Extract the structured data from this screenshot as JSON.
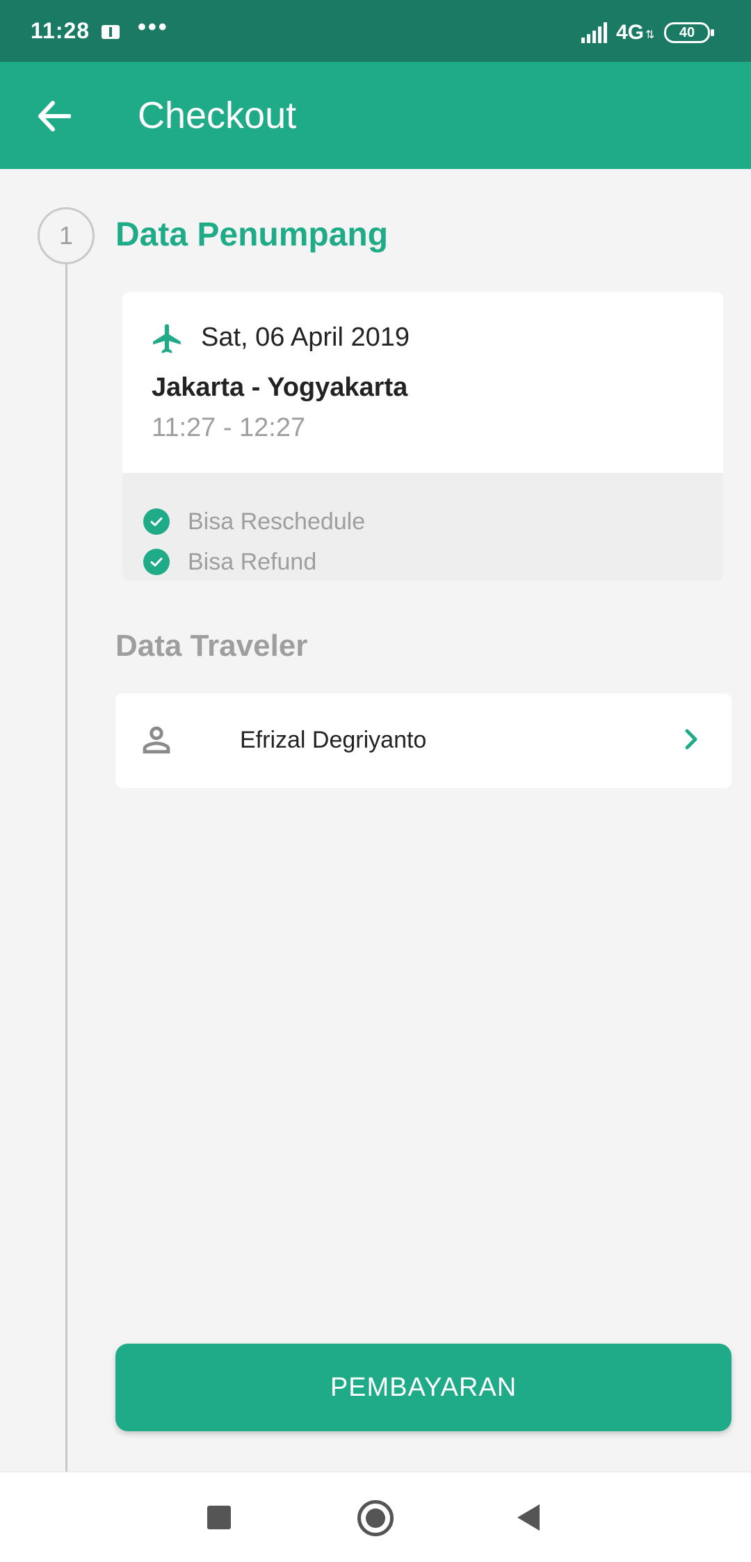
{
  "status_bar": {
    "time": "11:28",
    "dots": "•••",
    "network": "4G",
    "battery": "40"
  },
  "toolbar": {
    "title": "Checkout"
  },
  "step": {
    "number": "1",
    "title": "Data Penumpang"
  },
  "flight": {
    "date": "Sat, 06 April 2019",
    "route": "Jakarta - Yogyakarta",
    "time": "11:27 - 12:27",
    "features": [
      "Bisa Reschedule",
      "Bisa Refund"
    ]
  },
  "traveler": {
    "heading": "Data Traveler",
    "name": "Efrizal Degriyanto"
  },
  "pay_button": {
    "label": "PEMBAYARAN"
  },
  "colors": {
    "primary": "#20ab88",
    "status_bar": "#1b7a64",
    "background": "#f4f4f4",
    "muted_text": "#9e9e9e"
  },
  "icons": {
    "back": "arrow-left-icon",
    "plane": "airplane-icon",
    "check": "check-circle-icon",
    "person": "person-outline-icon",
    "chevron": "chevron-right-icon"
  }
}
